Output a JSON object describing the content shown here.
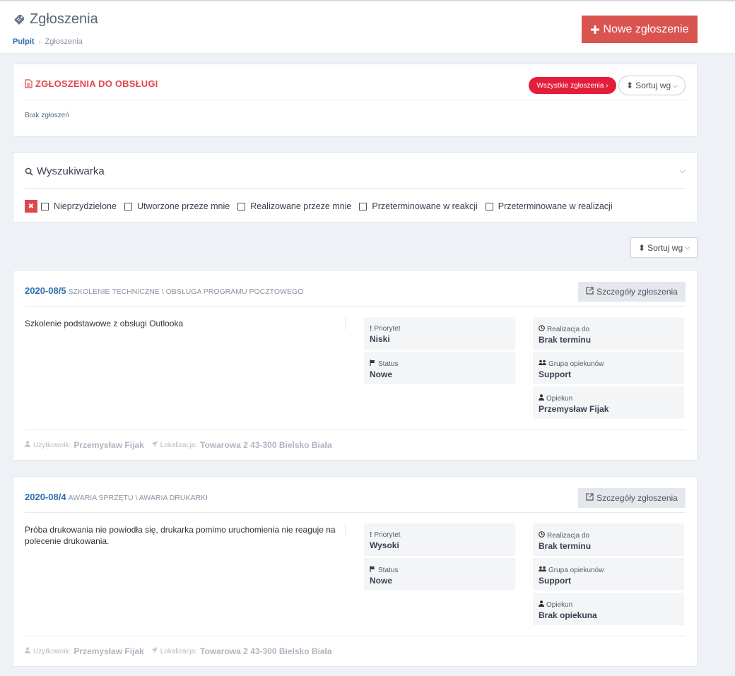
{
  "page": {
    "title": "Zgłoszenia",
    "breadcrumb": {
      "home": "Pulpit",
      "current": "Zgłoszenia"
    },
    "new_button": "Nowe zgłoszenie"
  },
  "pending_panel": {
    "title": "ZGŁOSZENIA DO OBSŁUGI",
    "all_button": "Wszystkie zgłoszenia ›",
    "sort_label": "Sortuj wg",
    "empty_text": "Brak zgłoszeń"
  },
  "search_panel": {
    "title": "Wyszukiwarka",
    "filters": [
      {
        "label": "Nieprzydzielone"
      },
      {
        "label": "Utworzone przeze mnie"
      },
      {
        "label": "Realizowane przeze mnie"
      },
      {
        "label": "Przeterminowane w reakcji"
      },
      {
        "label": "Przeterminowane w realizacji"
      }
    ]
  },
  "list_sort_label": "Sortuj wg",
  "tickets": [
    {
      "number": "2020-08/5",
      "category": "SZKOLENIE TECHNICZNE \\ OBSŁUGA PROGRAMU POCZTOWEGO",
      "details_button": "Szczegóły zgłoszenia",
      "description": "Szkolenie podstawowe z obsługi Outlooka",
      "priority_label": "Priorytet",
      "priority": "Niski",
      "status_label": "Status",
      "status": "Nowe",
      "deadline_label": "Realizacja do",
      "deadline": "Brak terminu",
      "group_label": "Grupa opiekunów",
      "group": "Support",
      "owner_label": "Opiekun",
      "owner": "Przemysław Fijak",
      "user_label": "Użytkownik:",
      "user": "Przemysław Fijak",
      "location_label": "Lokalizacja:",
      "location": "Towarowa 2 43-300 Bielsko Biała"
    },
    {
      "number": "2020-08/4",
      "category": "AWARIA SPRZĘTU \\ AWARIA DRUKARKI",
      "details_button": "Szczegóły zgłoszenia",
      "description": "Próba drukowania nie powiodła się, drukarka pomimo uruchomienia nie reaguje na polecenie drukowania.",
      "priority_label": "Priorytet",
      "priority": "Wysoki",
      "status_label": "Status",
      "status": "Nowe",
      "deadline_label": "Realizacja do",
      "deadline": "Brak terminu",
      "group_label": "Grupa opiekunów",
      "group": "Support",
      "owner_label": "Opiekun",
      "owner": "Brak opiekuna",
      "user_label": "Użytkownik:",
      "user": "Przemysław Fijak",
      "location_label": "Lokalizacja:",
      "location": "Towarowa 2 43-300 Bielsko Biała"
    }
  ],
  "colors": {
    "accent_red": "#d9534f",
    "link_blue": "#2f6fb0",
    "badge_red": "#e41e3a"
  }
}
